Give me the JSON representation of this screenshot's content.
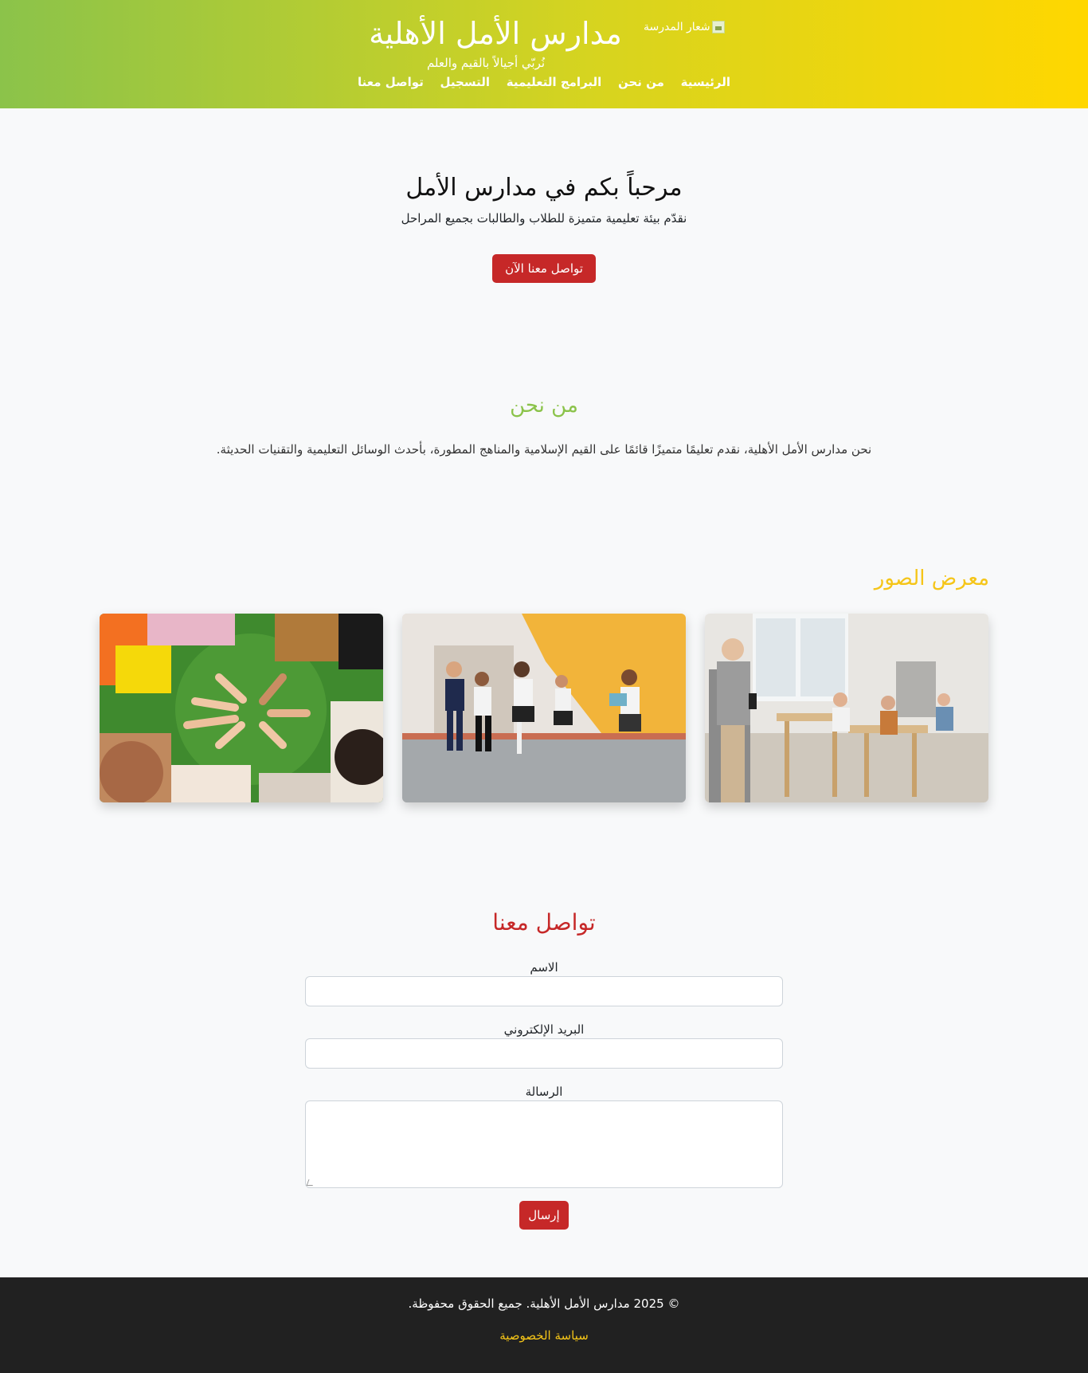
{
  "header": {
    "logo_alt": "شعار المدرسة",
    "title": "مدارس الأمل الأهلية",
    "tagline": "نُربّي أجيالاً بالقيم والعلم",
    "nav": [
      "الرئيسية",
      "من نحن",
      "البرامج التعليمية",
      "التسجيل",
      "تواصل معنا"
    ]
  },
  "hero": {
    "title": "مرحباً بكم في مدارس الأمل",
    "subtitle": "نقدّم بيئة تعليمية متميزة للطلاب والطالبات بجميع المراحل",
    "cta": "تواصل معنا الآن"
  },
  "about": {
    "title": "من نحن",
    "text": "نحن مدارس الأمل الأهلية، نقدم تعليمًا متميزًا قائمًا على القيم الإسلامية والمناهج المطورة، بأحدث الوسائل التعليمية والتقنيات الحديثة."
  },
  "gallery": {
    "title": "معرض الصور",
    "photos": [
      "classroom-photo",
      "running-students-photo",
      "hands-circle-photo"
    ]
  },
  "contact": {
    "title": "تواصل معنا",
    "name_label": "الاسم",
    "email_label": "البريد الإلكتروني",
    "message_label": "الرسالة",
    "submit": "إرسال"
  },
  "footer": {
    "copyright": "© 2025 مدارس الأمل الأهلية. جميع الحقوق محفوظة.",
    "privacy": "سياسة الخصوصية"
  },
  "colors": {
    "header_gradient_start": "#ffd700",
    "header_gradient_end": "#8bc34a",
    "primary_red": "#c62828",
    "about_green": "#8bc34a",
    "gallery_yellow": "#f5c518",
    "footer_bg": "#212121"
  }
}
